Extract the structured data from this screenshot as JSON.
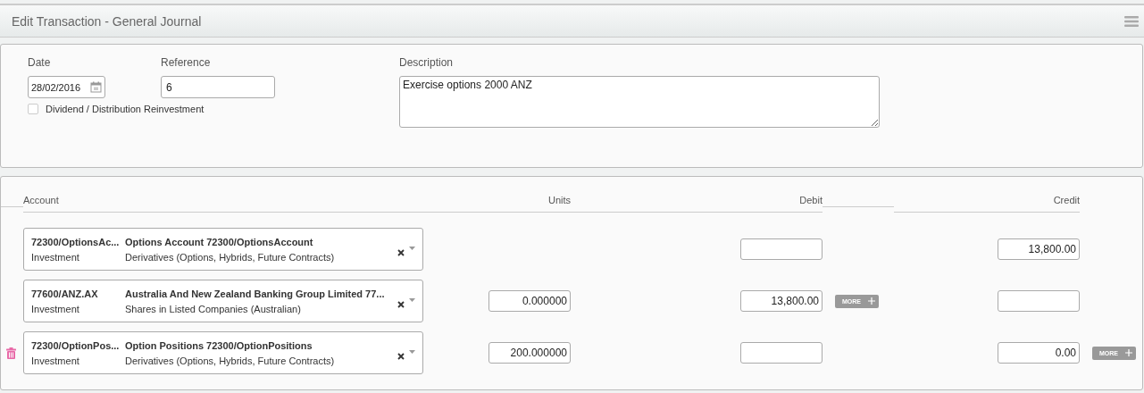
{
  "window": {
    "title": "Edit Transaction - General Journal"
  },
  "form": {
    "date": {
      "label": "Date",
      "value": "28/02/2016"
    },
    "reference": {
      "label": "Reference",
      "value": "6"
    },
    "description": {
      "label": "Description",
      "value": "Exercise options 2000 ANZ"
    },
    "reinvestment": {
      "label": "Dividend / Distribution Reinvestment",
      "checked": false
    }
  },
  "table": {
    "columns": [
      "Account",
      "Units",
      "Debit",
      "Credit"
    ],
    "rows": [
      {
        "code": "72300/OptionsAc...",
        "name": "Options Account 72300/OptionsAccount",
        "type": "Investment",
        "category": "Derivatives (Options, Hybrids, Future Contracts)",
        "credit": {
          "value": "13,800.00"
        },
        "deletable": false
      },
      {
        "code": "77600/ANZ.AX",
        "name": "Australia And New Zealand Banking Group Limited 77...",
        "type": "Investment",
        "category": "Shares in Listed Companies (Australian)",
        "units": {
          "value": "0.000000"
        },
        "debit": {
          "value": "13,800.00",
          "more": "MORE"
        },
        "deletable": false
      },
      {
        "code": "72300/OptionPos...",
        "name": "Option Positions 72300/OptionPositions",
        "type": "Investment",
        "category": "Derivatives (Options, Hybrids, Future Contracts)",
        "units": {
          "value": "200.000000"
        },
        "credit": {
          "value": "0.00",
          "more": "MORE"
        },
        "deletable": true
      }
    ]
  }
}
